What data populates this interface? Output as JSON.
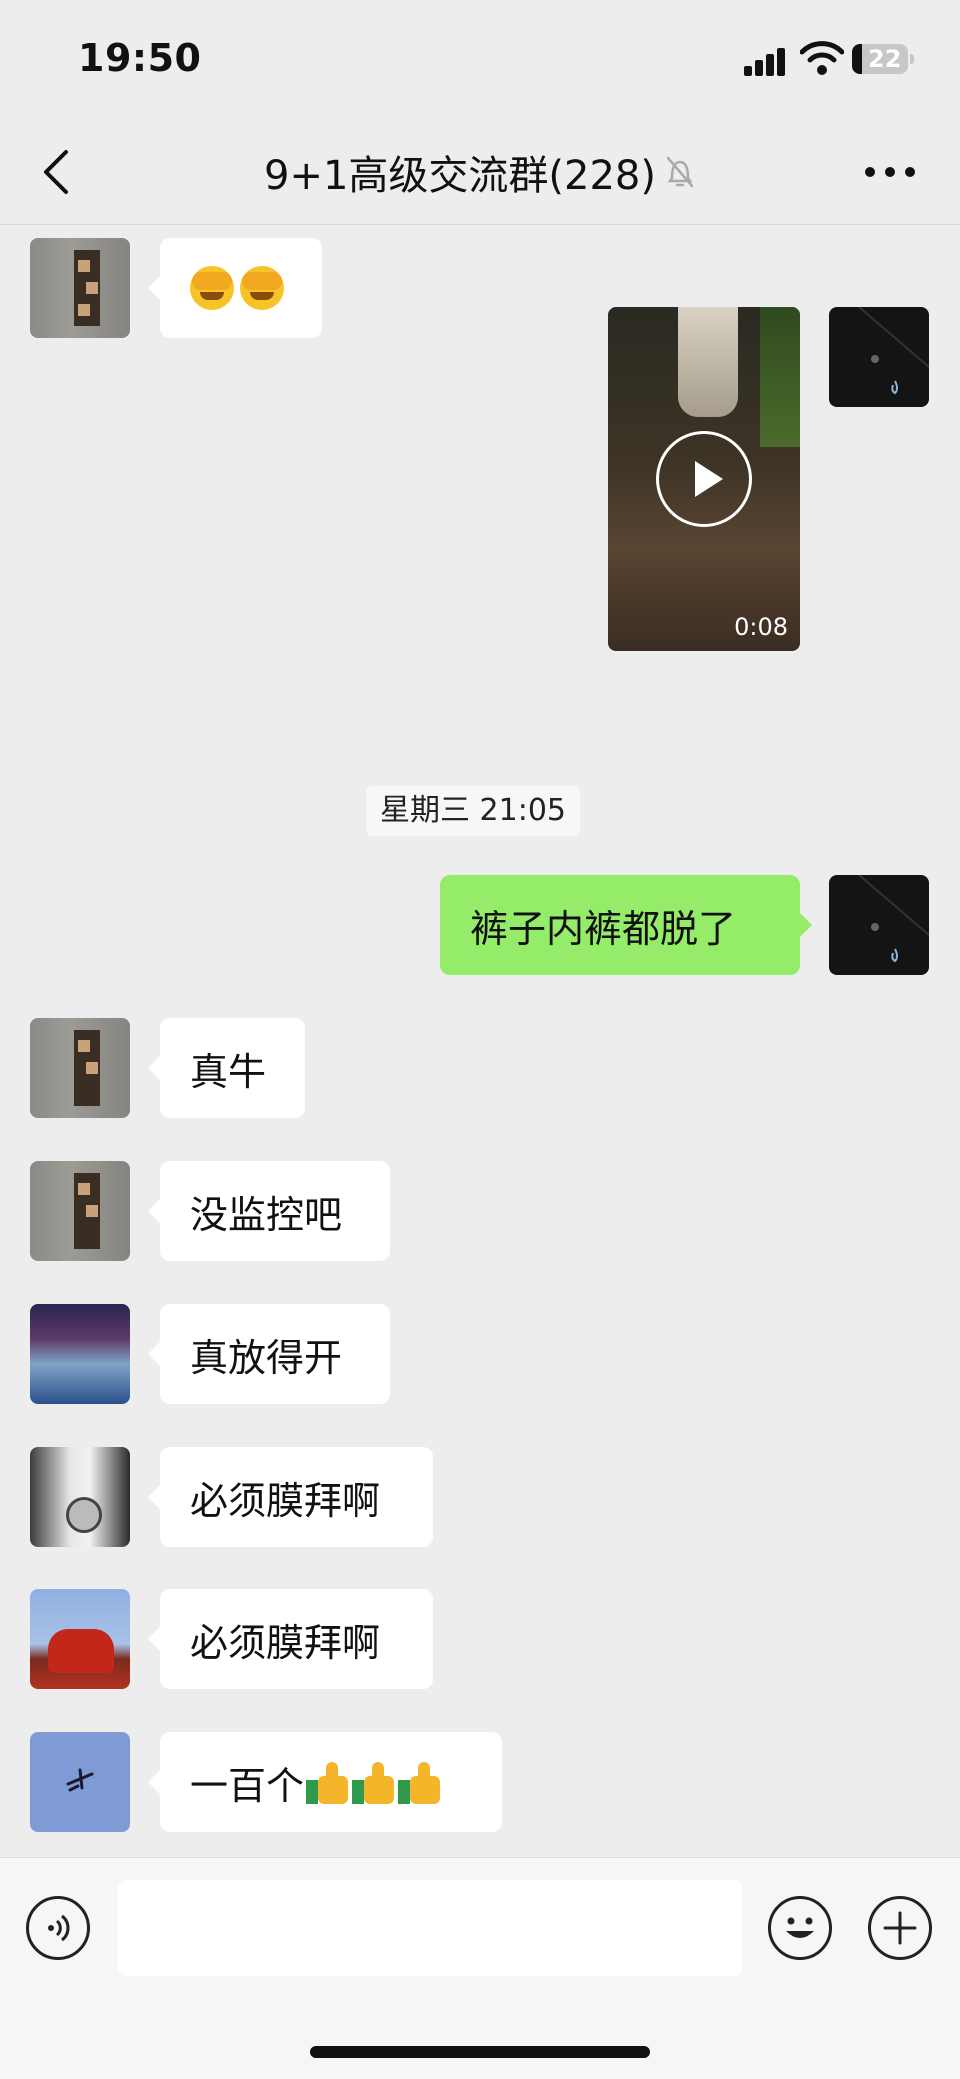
{
  "status_bar": {
    "time": "19:50",
    "battery": "22"
  },
  "nav": {
    "title": "9+1高级交流群(228)"
  },
  "messages": [
    {
      "sender": "left",
      "avatar": "building-avatar",
      "text": "",
      "emoji": [
        "face-palm-emoji",
        "face-palm-emoji"
      ]
    },
    {
      "sender": "self",
      "type": "video",
      "duration": "0:08"
    },
    {
      "type": "timestamp",
      "text": "星期三 21:05"
    },
    {
      "sender": "self",
      "text": "裤子内裤都脱了"
    },
    {
      "sender": "left",
      "avatar": "building-avatar",
      "text": "真牛"
    },
    {
      "sender": "left",
      "avatar": "building-avatar",
      "text": "没监控吧"
    },
    {
      "sender": "left",
      "avatar": "hall-avatar",
      "text": "真放得开"
    },
    {
      "sender": "left",
      "avatar": "watch-avatar",
      "text": "必须膜拜啊"
    },
    {
      "sender": "left",
      "avatar": "bull-avatar",
      "text": "必须膜拜啊"
    },
    {
      "sender": "left",
      "avatar": "plane-avatar",
      "text": "一百个",
      "emoji": [
        "thumbs-up-emoji",
        "thumbs-up-emoji",
        "thumbs-up-emoji"
      ]
    }
  ],
  "input": {
    "value": ""
  },
  "colors": {
    "background": "#ededed",
    "self_bubble": "#95ec69",
    "other_bubble": "#ffffff"
  }
}
